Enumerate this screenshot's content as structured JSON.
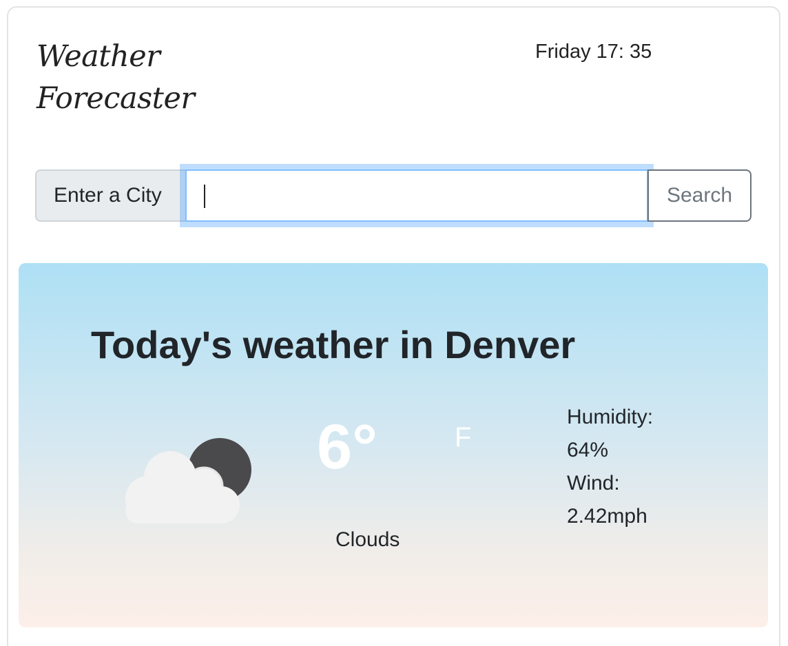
{
  "app": {
    "title": "Weather Forecaster"
  },
  "clock": {
    "text": "Friday 17: 35"
  },
  "search": {
    "label": "Enter a City",
    "value": "",
    "placeholder": "",
    "button_label": "Search"
  },
  "today": {
    "heading": "Today's weather in Denver",
    "temperature": "6°",
    "unit": "F",
    "condition": "Clouds",
    "icon": "cloud-moon-icon",
    "humidity_label": "Humidity:",
    "humidity_value": "64%",
    "wind_label": "Wind:",
    "wind_value": "2.42mph"
  },
  "colors": {
    "panel_top": "#aee0f5",
    "panel_bottom": "#fdefe9",
    "focus_ring": "#80bdff",
    "temperature_text": "#ffffff"
  }
}
